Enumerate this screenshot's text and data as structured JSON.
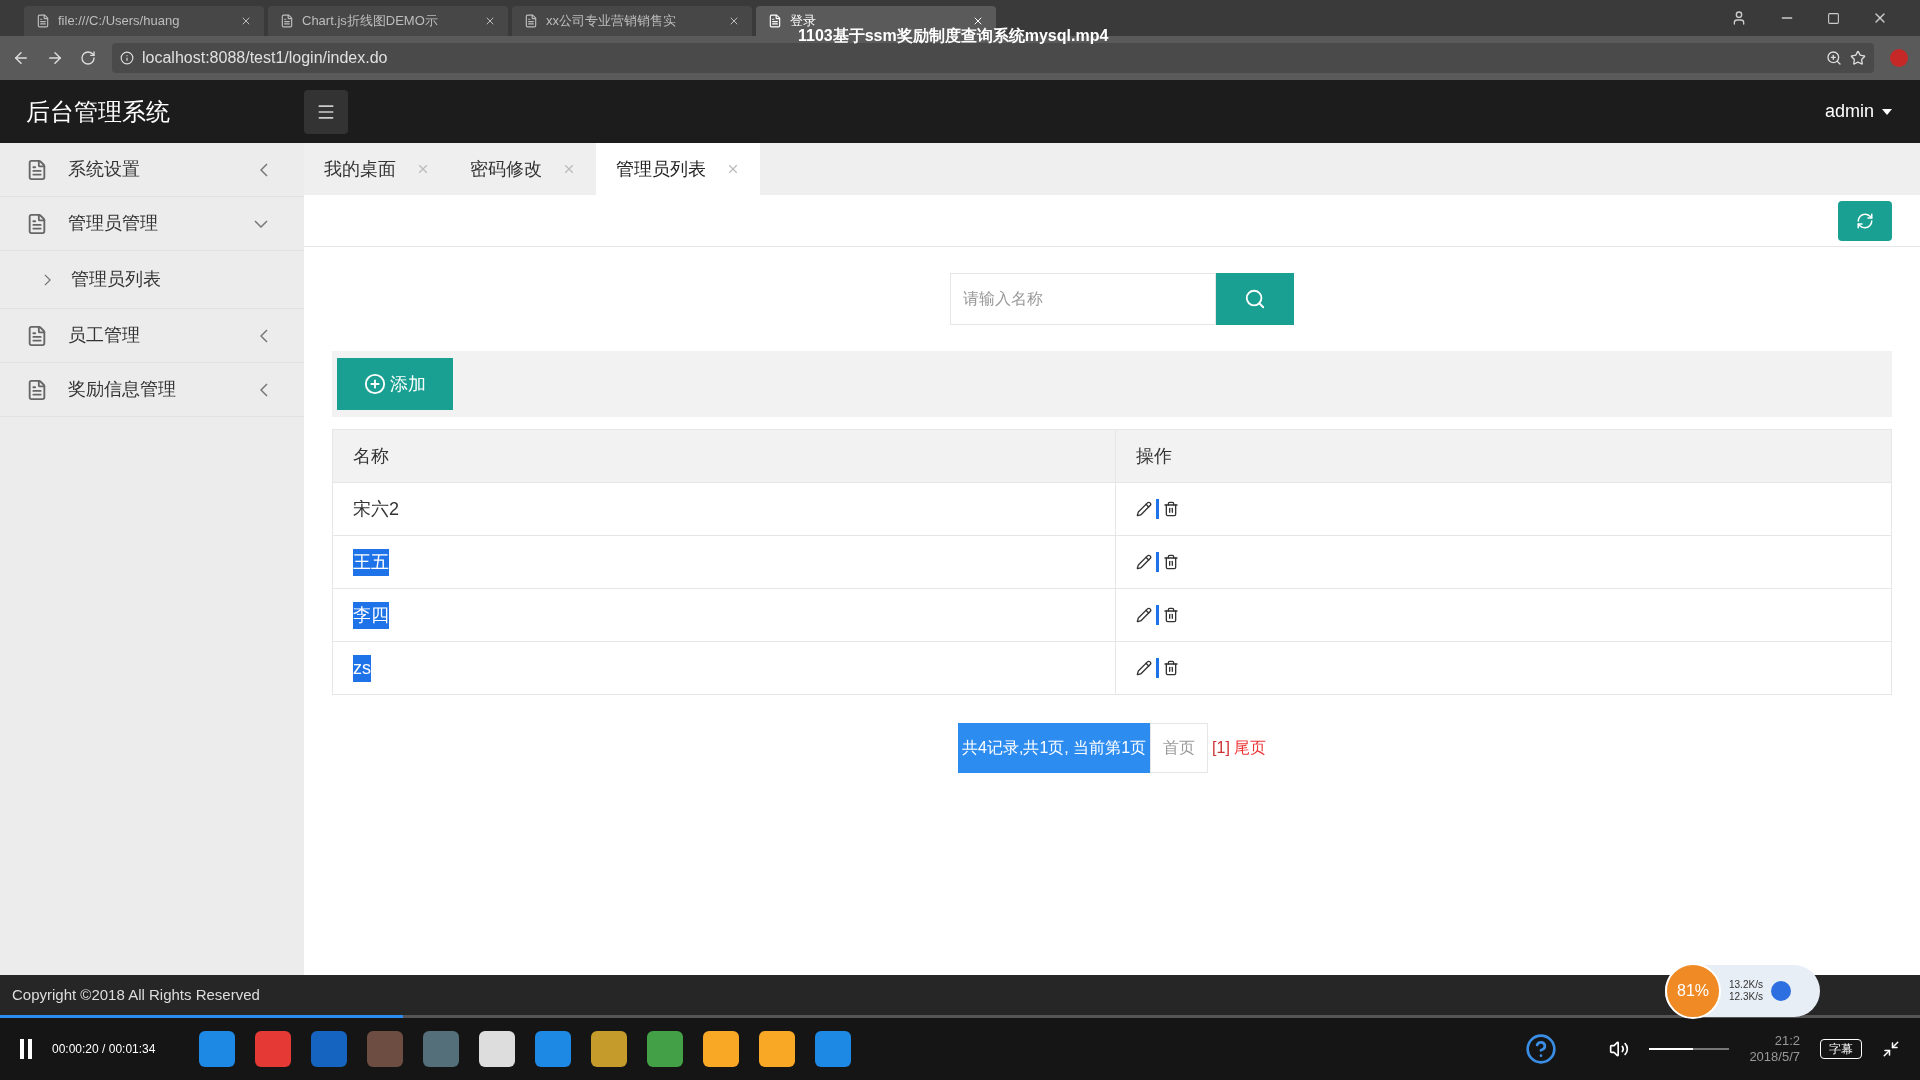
{
  "browser": {
    "tabs": [
      {
        "label": "file:///C:/Users/huang",
        "selected": false
      },
      {
        "label": "Chart.js折线图DEMO示",
        "selected": false
      },
      {
        "label": "xx公司专业营销销售实",
        "selected": false
      },
      {
        "label": "登录",
        "selected": true
      }
    ],
    "address": "localhost:8088/test1/login/index.do"
  },
  "video_title": "1103基于ssm奖励制度查询系统mysql.mp4",
  "header": {
    "title": "后台管理系统",
    "user": "admin"
  },
  "sidebar": {
    "items": [
      {
        "label": "系统设置",
        "expanded": false
      },
      {
        "label": "管理员管理",
        "expanded": true,
        "children": [
          {
            "label": "管理员列表"
          }
        ]
      },
      {
        "label": "员工管理",
        "expanded": false
      },
      {
        "label": "奖励信息管理",
        "expanded": false
      }
    ]
  },
  "tabs": [
    {
      "label": "我的桌面",
      "selected": false
    },
    {
      "label": "密码修改",
      "selected": false
    },
    {
      "label": "管理员列表",
      "selected": true
    }
  ],
  "search": {
    "placeholder": "请输入名称"
  },
  "add_button": "添加",
  "table": {
    "columns": [
      "名称",
      "操作"
    ],
    "rows": [
      {
        "name": "宋六2",
        "highlighted": false
      },
      {
        "name": "王五",
        "highlighted": true
      },
      {
        "name": "李四",
        "highlighted": true
      },
      {
        "name": "zs",
        "highlighted": true
      }
    ]
  },
  "pagination": {
    "summary": "共4记录,共1页, 当前第1页",
    "first": "首页",
    "pages": "[1]",
    "last": "尾页"
  },
  "footer": "Copyright ©2018 All Rights Reserved",
  "player": {
    "time": "00:00:20 / 00:01:34",
    "level": 0.21,
    "volume": {
      "level": 0.55
    },
    "subtitles": "字幕"
  },
  "monitor": {
    "percent": "81%",
    "up": "13.2K/s",
    "down": "12.3K/s"
  },
  "clock": {
    "time": "21:2",
    "date": "2018/5/7"
  }
}
